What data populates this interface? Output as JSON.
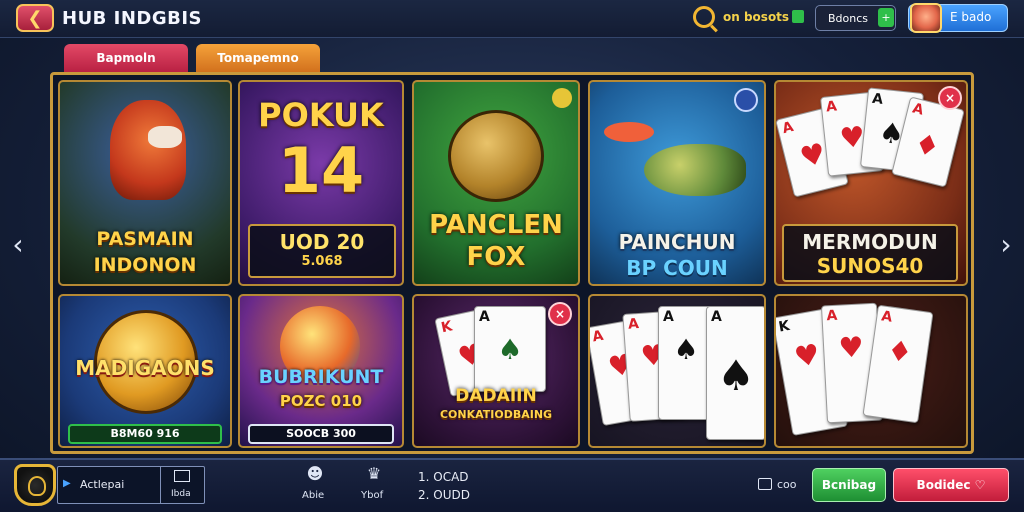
{
  "header": {
    "title": "HUB INDGBIS",
    "boosts_label": "on bosots",
    "coins_label": "Bdoncs",
    "coins_add": "+",
    "profile_name": "E bado"
  },
  "tabs": [
    {
      "label": "Bapmoln"
    },
    {
      "label": "Tomapemno"
    }
  ],
  "games": [
    {
      "title": "PASMAIN",
      "subtitle": "INDONON"
    },
    {
      "title": "POKUK",
      "number": "14",
      "value": "UOD 20",
      "value2": "5.068"
    },
    {
      "title": "PANCLEN",
      "subtitle": "FOX"
    },
    {
      "title": "PAINCHUN",
      "subtitle": "BP COUN"
    },
    {
      "title": "MERMODUN",
      "subtitle": "SUNOS40"
    },
    {
      "title": "MADIGAONS",
      "value": "B8M60 916"
    },
    {
      "title": "BUBRIKUNT",
      "subtitle": "POZC 010",
      "value": "SOOCB 300"
    },
    {
      "title": "DADAIIN",
      "subtitle": "CONKATIODBAING"
    },
    {
      "title": "",
      "subtitle": ""
    },
    {
      "title": "",
      "subtitle": ""
    }
  ],
  "cards": {
    "ace": "A",
    "king": "K",
    "spade": "♠",
    "heart": "♥",
    "diamond": "♦"
  },
  "close_symbol": "×",
  "nav": {
    "left": "‹",
    "right": "›"
  },
  "bottom": {
    "field_text": "Actlepai",
    "mail_label": "Ibda",
    "item1_label": "Abie",
    "item2_label": "Ybof",
    "rank1": "1. OCAD",
    "rank2": "2. OUDD",
    "cube_label": "coo",
    "green_button": "Bcnibag",
    "red_button": "Bodidec"
  },
  "colors": {
    "accent_gold": "#c89a3c",
    "tab_red": "#e34966",
    "tab_orange": "#f5a23a",
    "button_green": "#2fbf4a",
    "button_red": "#e0304a"
  }
}
